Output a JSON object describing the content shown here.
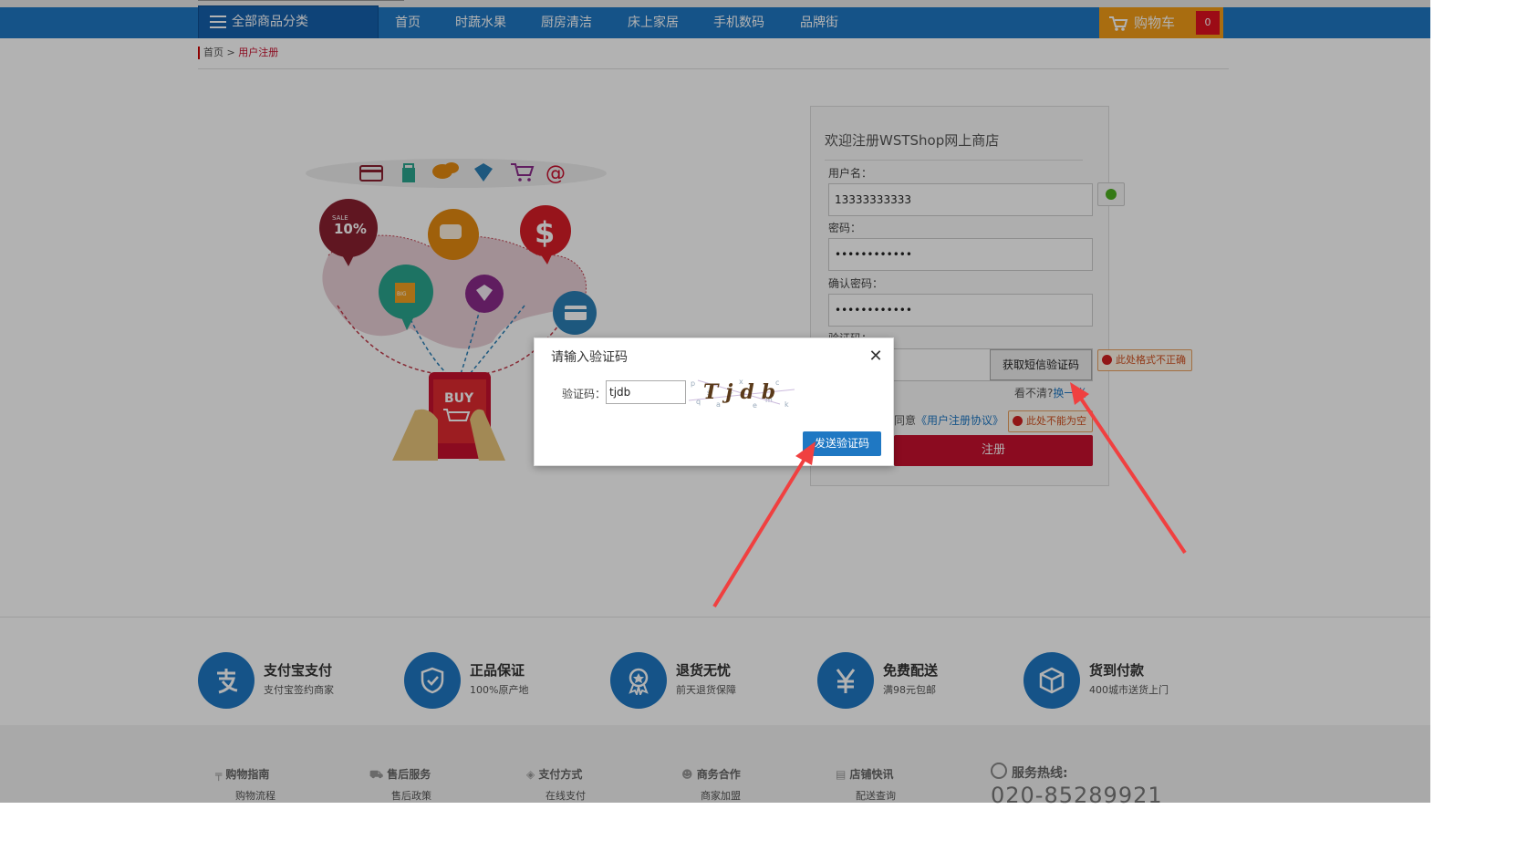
{
  "nav": {
    "all_categories": "全部商品分类",
    "items": [
      "首页",
      "时蔬水果",
      "厨房清洁",
      "床上家居",
      "手机数码",
      "品牌街"
    ],
    "cart_label": "购物车",
    "cart_count": "0"
  },
  "breadcrumb": {
    "home": "首页",
    "sep": ">",
    "current": "用户注册"
  },
  "banner": {
    "icons": [
      "card-icon",
      "bag-icon",
      "chat-icon",
      "diamond-icon",
      "cart-icon",
      "at-icon"
    ],
    "sale_text": "SALE 10%",
    "dollar": "$",
    "big_sale": "BIG SALE",
    "buy": "BUY"
  },
  "register": {
    "title": "欢迎注册WSTShop网上商店",
    "username_label": "用户名：",
    "username_value": "13333333333",
    "password_label": "密码：",
    "password_value": "••••••••••••",
    "confirm_label": "确认密码：",
    "confirm_value": "••••••••••••",
    "captcha_label": "验证码：",
    "sms_button": "获取短信验证码",
    "unclear_text": "看不清?",
    "refresh_link": "换一张",
    "agree_prefix": "同意",
    "agreement_link": "《用户注册协议》",
    "submit": "注册",
    "tip_format": "此处格式不正确",
    "tip_empty": "此处不能为空"
  },
  "dialog": {
    "title": "请输入验证码",
    "close": "✕",
    "label": "验证码：",
    "input_value": "tjdb",
    "captcha_text": "Tjdb",
    "send_button": "发送验证码"
  },
  "features": [
    {
      "title": "支付宝支付",
      "sub": "支付宝签约商家"
    },
    {
      "title": "正品保证",
      "sub": "100%原产地"
    },
    {
      "title": "退货无忧",
      "sub": "前天退货保障"
    },
    {
      "title": "免费配送",
      "sub": "满98元包邮"
    },
    {
      "title": "货到付款",
      "sub": "400城市送货上门"
    }
  ],
  "footer": {
    "columns": [
      {
        "title": "购物指南",
        "link": "购物流程"
      },
      {
        "title": "售后服务",
        "link": "售后政策"
      },
      {
        "title": "支付方式",
        "link": "在线支付"
      },
      {
        "title": "商务合作",
        "link": "商家加盟"
      },
      {
        "title": "店铺快讯",
        "link": "配送查询"
      }
    ],
    "hotline_label": "服务热线:",
    "hotline": "020-85289921"
  },
  "colors": {
    "nav_blue": "#1f78c3",
    "cart_orange": "#f29c17",
    "brand_red": "#c8102e",
    "arrow_red": "#f04040"
  }
}
